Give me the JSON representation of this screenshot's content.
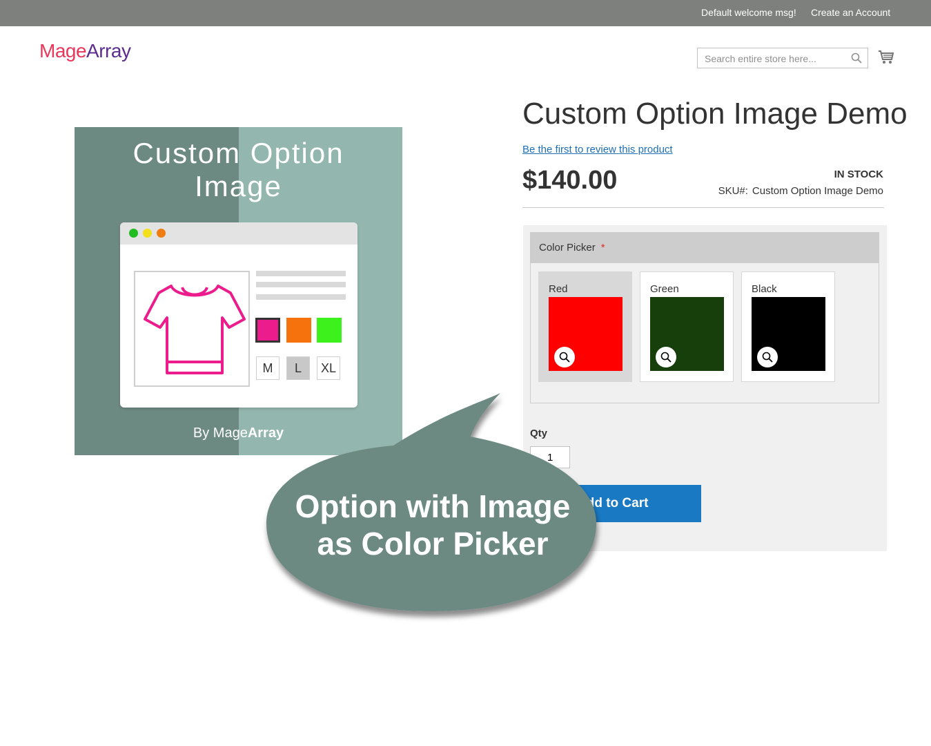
{
  "header": {
    "welcome": "Default welcome msg!",
    "create_account": "Create an Account"
  },
  "logo": {
    "mage": "Mage",
    "array": "Array"
  },
  "search": {
    "placeholder": "Search entire store here..."
  },
  "product_image": {
    "title_line1": "Custom Option",
    "title_line2": "Image",
    "by_prefix": "By Mage",
    "by_brand": "Array",
    "sizes": [
      "M",
      "L",
      "XL"
    ]
  },
  "product": {
    "title": "Custom Option Image Demo",
    "review_link": "Be the first to review this product",
    "price": "$140.00",
    "stock": "IN STOCK",
    "sku_label": "SKU#:",
    "sku_value": "Custom Option Image Demo"
  },
  "option": {
    "label": "Color Picker",
    "required_mark": "*",
    "swatches": [
      {
        "name": "Red",
        "color": "#ff0000",
        "selected": true
      },
      {
        "name": "Green",
        "color": "#173f0b",
        "selected": false
      },
      {
        "name": "Black",
        "color": "#000000",
        "selected": false
      }
    ]
  },
  "qty": {
    "label": "Qty",
    "value": "1"
  },
  "add_to_cart": "Add to Cart",
  "callout": {
    "line1": "Option with Image",
    "line2": "as Color Picker"
  },
  "colors": {
    "topbar": "#7d807c",
    "accent_button": "#1979c3",
    "bubble": "#6d8a82",
    "link": "#1f6fb5"
  }
}
